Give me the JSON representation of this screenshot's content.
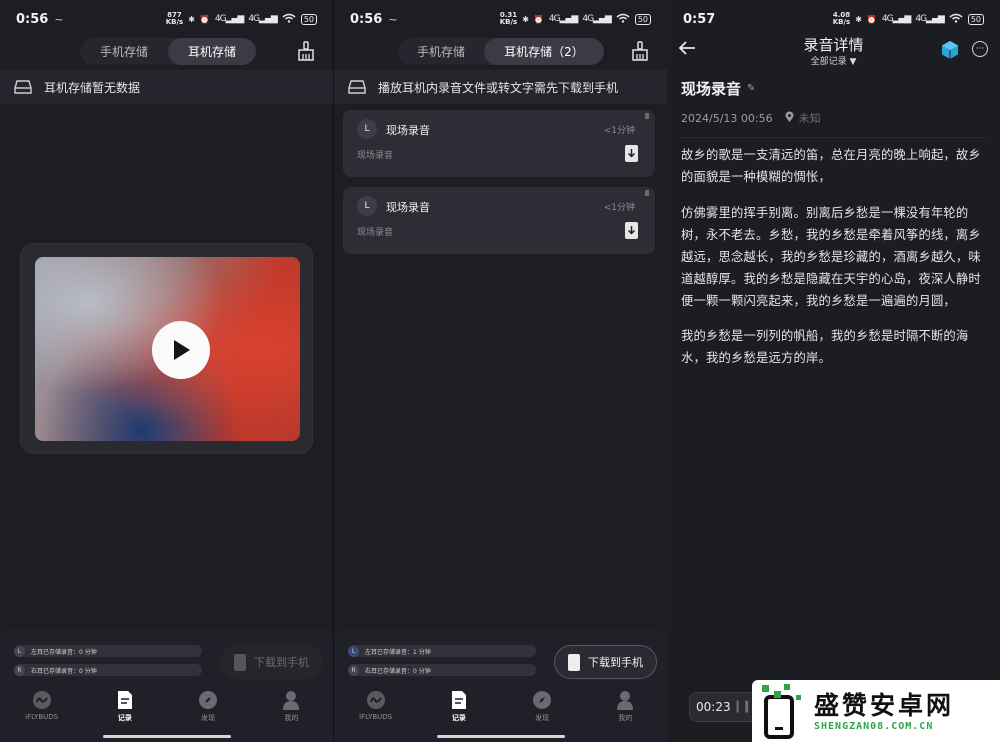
{
  "panel1": {
    "status": {
      "time": "0:56",
      "wave": "~",
      "speed_top": "877",
      "speed_bottom": "KB/s",
      "signal1": "4G",
      "signal2": "4G",
      "battery": "50"
    },
    "tabs": {
      "phone": "手机存储",
      "earphone": "耳机存储"
    },
    "banner": "耳机存储暂无数据",
    "storage": {
      "left": "左耳已存储录音：0 分钟",
      "right": "右耳已存储录音：0 分钟",
      "l": "L",
      "r": "R"
    },
    "download_label": "下载到手机"
  },
  "panel2": {
    "status": {
      "time": "0:56",
      "wave": "~",
      "speed_top": "0.31",
      "speed_bottom": "KB/s",
      "signal1": "4G",
      "signal2": "4G",
      "battery": "50"
    },
    "tabs": {
      "phone": "手机存储",
      "earphone": "耳机存储（2）"
    },
    "banner": "播放耳机内录音文件或转文字需先下载到手机",
    "recordings": [
      {
        "badge": "L",
        "title": "现场录音",
        "duration": "<1分钟",
        "subtitle": "现场录音"
      },
      {
        "badge": "L",
        "title": "现场录音",
        "duration": "<1分钟",
        "subtitle": "现场录音"
      }
    ],
    "storage": {
      "left": "左耳已存储录音：1 分钟",
      "right": "右耳已存储录音：0 分钟",
      "l": "L",
      "r": "R"
    },
    "download_label": "下载到手机"
  },
  "nav": [
    {
      "label": "iFLYBUDS",
      "icon": "iflybuds-icon"
    },
    {
      "label": "记录",
      "icon": "document-icon"
    },
    {
      "label": "发现",
      "icon": "compass-icon"
    },
    {
      "label": "我的",
      "icon": "person-icon"
    }
  ],
  "panel3": {
    "status": {
      "time": "0:57",
      "speed_top": "4.08",
      "speed_bottom": "KB/s",
      "signal1": "4G",
      "signal2": "4G",
      "battery": "50"
    },
    "header_title": "录音详情",
    "header_sub": "全部记录 ▼",
    "record_title": "现场录音",
    "datetime": "2024/5/13 00:56",
    "location": "未知",
    "paragraphs": [
      "故乡的歌是一支清远的笛，总在月亮的晚上响起，故乡的面貌是一种模糊的惆怅，",
      "仿佛雾里的挥手别离。别离后乡愁是一棵没有年轮的树，永不老去。乡愁，我的乡愁是牵着风筝的线，离乡越远，思念越长，我的乡愁是珍藏的，酒离乡越久，味道越醇厚。我的乡愁是隐藏在天宇的心岛，夜深人静时便一颗一颗闪亮起来，我的乡愁是一遍遍的月圆，",
      "我的乡愁是一列列的帆船，我的乡愁是时隔不断的海水，我的乡愁是远方的岸。"
    ],
    "player_time": "00:23"
  },
  "watermark": {
    "cn": "盛赞安卓网",
    "en": "SHENGZAN08.COM.CN"
  },
  "colors": {
    "bg": "#1d1e24",
    "card": "#2d2e35",
    "accent_green": "#2fa54a",
    "video_red": "#d9412e"
  }
}
